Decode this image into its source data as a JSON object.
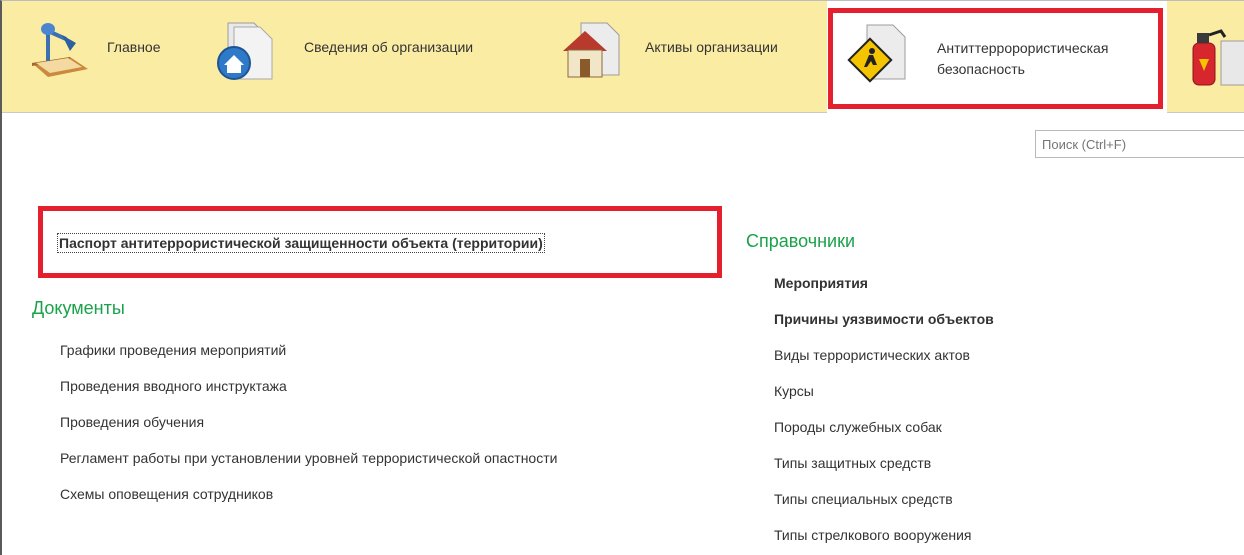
{
  "sections": [
    {
      "label": "Главное",
      "icon": "desk-lamp-icon"
    },
    {
      "label": "Сведения об организации",
      "icon": "folder-home-icon"
    },
    {
      "label": "Активы организации",
      "icon": "folder-house-icon"
    },
    {
      "label_line1": "Антиттерророристическая",
      "label_line2": "безопасность",
      "icon": "folder-warning-sign-icon",
      "active": true
    },
    {
      "label": "",
      "icon": "fire-extinguisher-icon"
    }
  ],
  "search": {
    "placeholder": "Поиск (Ctrl+F)"
  },
  "passport_link": "Паспорт антитеррористической защищенности объекта (территории)",
  "documents": {
    "title": "Документы",
    "items": [
      "Графики проведения мероприятий",
      "Проведения вводного инструктажа",
      "Проведения обучения",
      "Регламент работы при установлении уровней террористической опастности",
      "Схемы оповещения сотрудников"
    ]
  },
  "references": {
    "title": "Справочники",
    "items": [
      {
        "label": "Мероприятия",
        "bold": true
      },
      {
        "label": "Причины уязвимости объектов",
        "bold": true
      },
      {
        "label": "Виды террористических актов",
        "bold": false
      },
      {
        "label": "Курсы",
        "bold": false
      },
      {
        "label": "Породы служебных собак",
        "bold": false
      },
      {
        "label": "Типы защитных средств",
        "bold": false
      },
      {
        "label": "Типы специальных средств",
        "bold": false
      },
      {
        "label": "Типы стрелкового вооружения",
        "bold": false
      }
    ]
  },
  "colors": {
    "panel": "#fbeca4",
    "highlight": "#e5202e",
    "heading": "#1aa24a"
  }
}
